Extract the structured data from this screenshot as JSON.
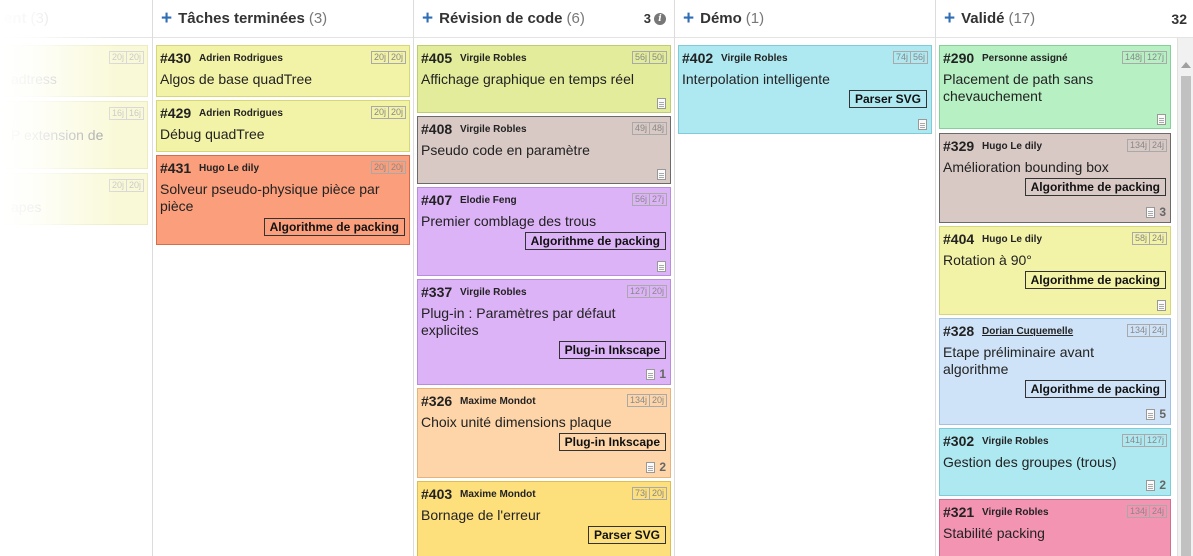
{
  "columns": {
    "col0": {
      "title": "ent",
      "count": "(3)"
    },
    "col1": {
      "title": "Tâches terminées",
      "count": "(3)"
    },
    "col2": {
      "title": "Révision de code",
      "count": "(6)",
      "right": "3"
    },
    "col3": {
      "title": "Démo",
      "count": "(1)"
    },
    "col4": {
      "title": "Validé",
      "count": "(17)",
      "right": "32"
    }
  },
  "cards": {
    "c0a": {
      "title": "adtress",
      "est": [
        "20j",
        "20j"
      ]
    },
    "c0b": {
      "title": "P extension de",
      "est": [
        "16j",
        "16j"
      ]
    },
    "c0c": {
      "title": "apes",
      "est": [
        "20j",
        "20j"
      ]
    },
    "c430": {
      "num": "#430",
      "assignee": "Adrien Rodrigues",
      "est": [
        "20j",
        "20j"
      ],
      "title": "Algos de base quadTree"
    },
    "c429": {
      "num": "#429",
      "assignee": "Adrien Rodrigues",
      "est": [
        "20j",
        "20j"
      ],
      "title": "Débug quadTree"
    },
    "c431": {
      "num": "#431",
      "assignee": "Hugo Le dily",
      "est": [
        "20j",
        "20j"
      ],
      "title": "Solveur pseudo-physique pièce par pièce",
      "tag": "Algorithme de packing"
    },
    "c405": {
      "num": "#405",
      "assignee": "Virgile Robles",
      "est": [
        "56j",
        "50j"
      ],
      "title": "Affichage graphique en temps réel"
    },
    "c408": {
      "num": "#408",
      "assignee": "Virgile Robles",
      "est": [
        "49j",
        "48j"
      ],
      "title": "Pseudo code en paramètre"
    },
    "c407": {
      "num": "#407",
      "assignee": "Elodie Feng",
      "est": [
        "56j",
        "27j"
      ],
      "title": "Premier comblage des trous",
      "tag": "Algorithme de packing"
    },
    "c337": {
      "num": "#337",
      "assignee": "Virgile Robles",
      "est": [
        "127j",
        "20j"
      ],
      "title": "Plug-in : Paramètres par défaut explicites",
      "tag": "Plug-in Inkscape",
      "docs": "1"
    },
    "c326": {
      "num": "#326",
      "assignee": "Maxime Mondot",
      "est": [
        "134j",
        "20j"
      ],
      "title": "Choix unité dimensions plaque",
      "tag": "Plug-in Inkscape",
      "docs": "2"
    },
    "c403": {
      "num": "#403",
      "assignee": "Maxime Mondot",
      "est": [
        "73j",
        "20j"
      ],
      "title": "Bornage de l'erreur",
      "tag": "Parser SVG"
    },
    "c402": {
      "num": "#402",
      "assignee": "Virgile Robles",
      "est": [
        "74j",
        "56j"
      ],
      "title": "Interpolation intelligente",
      "tag": "Parser SVG"
    },
    "c290": {
      "num": "#290",
      "assignee": "Personne assigné",
      "est": [
        "148j",
        "127j"
      ],
      "title": "Placement de path sans chevauchement"
    },
    "c329": {
      "num": "#329",
      "assignee": "Hugo Le dily",
      "est": [
        "134j",
        "24j"
      ],
      "title": "Amélioration bounding box",
      "tag": "Algorithme de packing",
      "docs": "3"
    },
    "c404": {
      "num": "#404",
      "assignee": "Hugo Le dily",
      "est": [
        "58j",
        "24j"
      ],
      "title": "Rotation à 90°",
      "tag": "Algorithme de packing"
    },
    "c328": {
      "num": "#328",
      "assignee": "Dorian Cuquemelle",
      "est": [
        "134j",
        "24j"
      ],
      "title": "Etape préliminaire avant algorithme",
      "tag": "Algorithme de packing",
      "docs": "5"
    },
    "c302": {
      "num": "#302",
      "assignee": "Virgile Robles",
      "est": [
        "141j",
        "127j"
      ],
      "title": "Gestion des groupes (trous)",
      "docs": "2"
    },
    "c321": {
      "num": "#321",
      "assignee": "Virgile Robles",
      "est": [
        "134j",
        "24j"
      ],
      "title": "Stabilité packing"
    }
  },
  "icons": {
    "add": "plus-icon",
    "info": "info-icon",
    "document": "document-icon"
  },
  "colors": {
    "accent": "#2f6db5",
    "yellow": "#f3f3a8",
    "orange": "#fb9e7c",
    "taupe": "#d8c9c5",
    "purple": "#dcb3f7",
    "peach": "#fdd5a8",
    "gold": "#fddf7c",
    "cyan": "#aee8f1",
    "green": "#b6f0c3",
    "lightblue": "#cfe3f8",
    "pink": "#f394b3"
  }
}
